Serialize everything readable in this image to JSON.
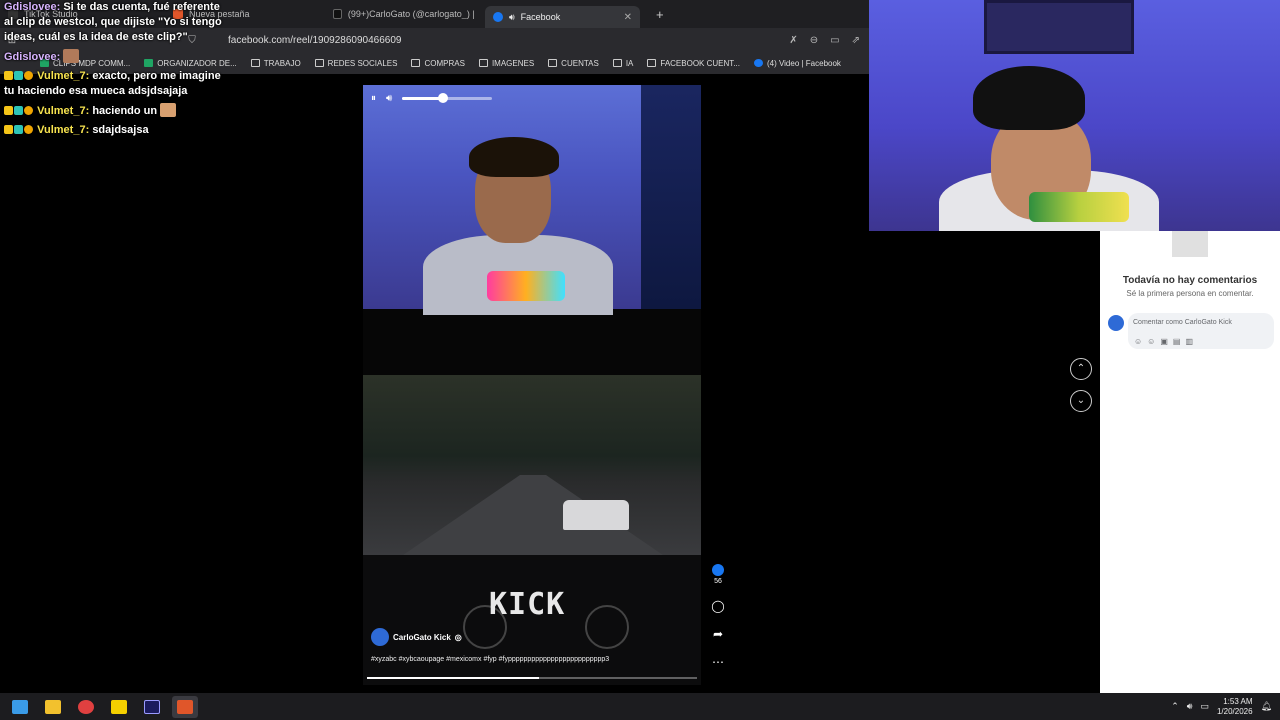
{
  "browser": {
    "tabs": [
      {
        "label": "TikTok Studio",
        "active": false
      },
      {
        "label": "Nueva pestaña",
        "active": false
      },
      {
        "label": "(99+)CarloGato (@carlogato_) | TikTo",
        "active": false
      },
      {
        "label": "Facebook",
        "active": true
      }
    ],
    "url": "facebook.com/reel/1909286090466609",
    "bookmarks": [
      "CLIPS MDP COMM...",
      "ORGANIZADOR DE...",
      "TRABAJO",
      "REDES SOCIALES",
      "COMPRAS",
      "IMAGENES",
      "CUENTAS",
      "IA",
      "FACEBOOK CUENT...",
      "(4) Video | Facebook"
    ]
  },
  "chat": {
    "messages": [
      {
        "user": "Gdislovee",
        "text": "Si te das cuenta, fué referente al clip de westcol, que dijiste \"Yo si tengo ideas, cuál es la idea de este clip?\""
      },
      {
        "user": "Gdislovee",
        "text": ""
      },
      {
        "user": "Vulmet_7",
        "text": "exacto, pero me imagine tu haciendo esa mueca adsjdsajaja"
      },
      {
        "user": "Vulmet_7",
        "text": "haciendo un"
      },
      {
        "user": "Vulmet_7",
        "text": "sdajdsajsa"
      }
    ]
  },
  "reel": {
    "author": "CarloGato Kick",
    "hashtags": "#xyzabc #xybcaoupage #mexicomx #fyp #fyppppppppppppppppppppppppp3",
    "overlay_logo": "KICK",
    "likes": "56",
    "volume": 0.45,
    "progress": 0.52
  },
  "comments_panel": {
    "empty_title": "Todavía no hay comentarios",
    "empty_subtitle": "Sé la primera persona en comentar.",
    "input_placeholder": "Comentar como CarloGato Kick"
  },
  "taskbar": {
    "time": "1:53 AM",
    "date": "1/20/2026"
  },
  "colors": {
    "facebook_blue": "#1877f2",
    "chat_pink": "#d8b4ff",
    "chat_yellow": "#f7e34f"
  }
}
